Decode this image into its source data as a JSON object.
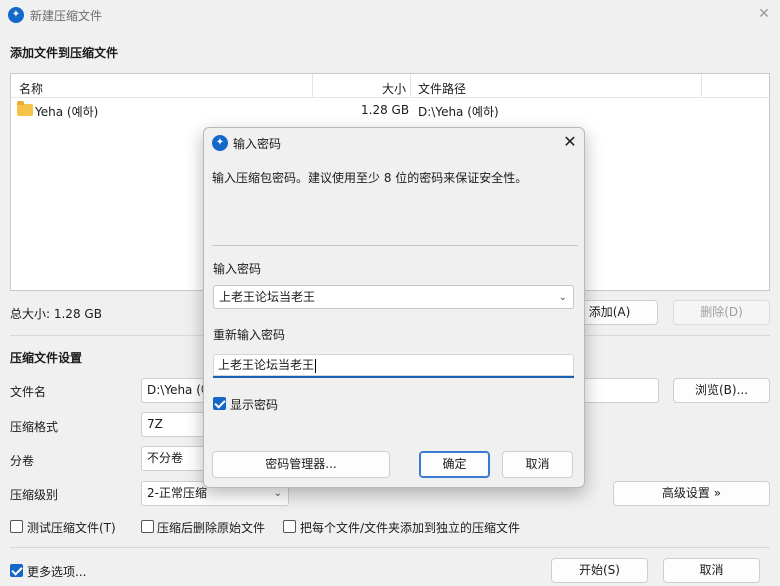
{
  "window": {
    "title": "新建压缩文件",
    "close_glyph": "✕"
  },
  "add_section": {
    "title": "添加文件到压缩文件",
    "columns": [
      "名称",
      "大小",
      "文件路径"
    ],
    "rows": [
      {
        "name": "Yeha (예하)",
        "size": "1.28 GB",
        "path": "D:\\Yeha (예하)",
        "icon": "folder-icon"
      }
    ],
    "total_size": "总大小: 1.28 GB",
    "add_button": "添加(A)",
    "delete_button": "删除(D)"
  },
  "settings": {
    "title": "压缩文件设置",
    "filename_label": "文件名",
    "filename_value": "D:\\Yeha (예",
    "browse_button": "浏览(B)...",
    "format_label": "压缩格式",
    "format_value": "7Z",
    "split_label": "分卷",
    "split_value": "不分卷",
    "level_label": "压缩级别",
    "level_value": "2-正常压缩",
    "advanced_button": "高级设置 »",
    "test_checkbox": "测试压缩文件(T)",
    "delete_after_checkbox": "压缩后删除原始文件",
    "separate_checkbox": "把每个文件/文件夹添加到独立的压缩文件"
  },
  "footer": {
    "more_options": "更多选项...",
    "start_button": "开始(S)",
    "cancel_button": "取消"
  },
  "dialog": {
    "title": "输入密码",
    "close_glyph": "✕",
    "description": "输入压缩包密码。建议使用至少 8 位的密码来保证安全性。",
    "password_label": "输入密码",
    "password_value": "上老王论坛当老王",
    "confirm_label": "重新输入密码",
    "confirm_value": "上老王论坛当老王",
    "show_password": "显示密码",
    "manager_button": "密码管理器...",
    "ok_button": "确定",
    "cancel_button": "取消"
  },
  "colors": {
    "accent": "#1467c8",
    "window_bg": "#f0f0f0"
  }
}
